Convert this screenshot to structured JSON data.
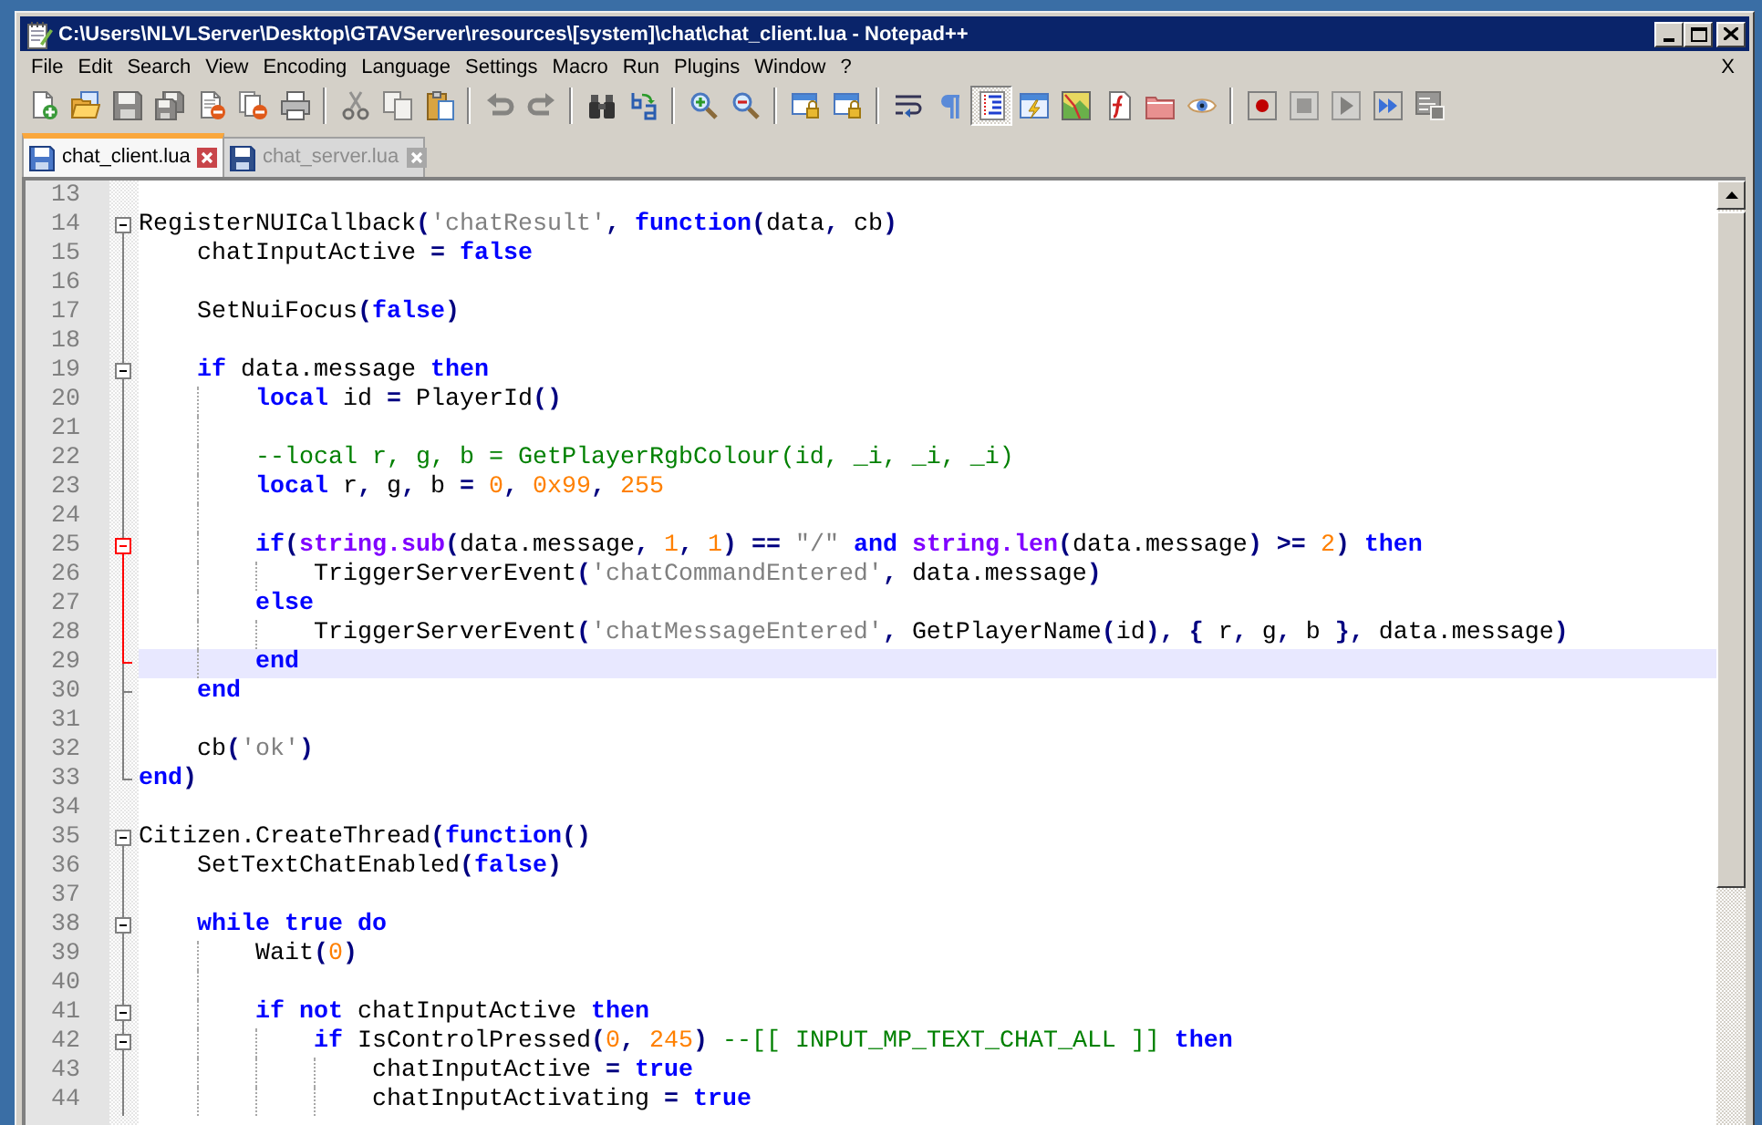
{
  "window": {
    "title": "C:\\Users\\NLVLServer\\Desktop\\GTAVServer\\resources\\[system]\\chat\\chat_client.lua - Notepad++"
  },
  "menu": {
    "items": [
      "File",
      "Edit",
      "Search",
      "View",
      "Encoding",
      "Language",
      "Settings",
      "Macro",
      "Run",
      "Plugins",
      "Window",
      "?"
    ],
    "close_button": "X"
  },
  "toolbar": [
    {
      "kind": "button",
      "disabled": false,
      "pressed": false
    },
    {
      "kind": "button",
      "disabled": false,
      "pressed": false
    },
    {
      "kind": "button",
      "disabled": true,
      "pressed": false
    },
    {
      "kind": "button",
      "disabled": true,
      "pressed": false
    },
    {
      "kind": "button",
      "disabled": false,
      "pressed": false
    },
    {
      "kind": "button",
      "disabled": false,
      "pressed": false
    },
    {
      "kind": "button",
      "disabled": false,
      "pressed": false
    },
    {
      "kind": "separator"
    },
    {
      "kind": "button",
      "disabled": true,
      "pressed": false
    },
    {
      "kind": "button",
      "disabled": true,
      "pressed": false
    },
    {
      "kind": "button",
      "disabled": false,
      "pressed": false
    },
    {
      "kind": "separator"
    },
    {
      "kind": "button",
      "disabled": true,
      "pressed": false
    },
    {
      "kind": "button",
      "disabled": true,
      "pressed": false
    },
    {
      "kind": "separator"
    },
    {
      "kind": "button",
      "disabled": false,
      "pressed": false
    },
    {
      "kind": "button",
      "disabled": false,
      "pressed": false
    },
    {
      "kind": "separator"
    },
    {
      "kind": "button",
      "disabled": false,
      "pressed": false
    },
    {
      "kind": "button",
      "disabled": false,
      "pressed": false
    },
    {
      "kind": "separator"
    },
    {
      "kind": "button",
      "disabled": false,
      "pressed": false
    },
    {
      "kind": "button",
      "disabled": false,
      "pressed": false
    },
    {
      "kind": "separator"
    },
    {
      "kind": "button",
      "disabled": false,
      "pressed": false
    },
    {
      "kind": "button",
      "disabled": false,
      "pressed": false
    },
    {
      "kind": "button",
      "disabled": false,
      "pressed": true
    },
    {
      "kind": "button",
      "disabled": false,
      "pressed": false
    },
    {
      "kind": "button",
      "disabled": false,
      "pressed": false
    },
    {
      "kind": "button",
      "disabled": false,
      "pressed": false
    },
    {
      "kind": "button",
      "disabled": false,
      "pressed": false
    },
    {
      "kind": "button",
      "disabled": false,
      "pressed": false
    },
    {
      "kind": "separator"
    },
    {
      "kind": "button",
      "disabled": false,
      "pressed": false
    },
    {
      "kind": "button",
      "disabled": true,
      "pressed": false
    },
    {
      "kind": "button",
      "disabled": true,
      "pressed": false
    },
    {
      "kind": "button",
      "disabled": false,
      "pressed": false
    },
    {
      "kind": "button",
      "disabled": true,
      "pressed": false
    }
  ],
  "tabs": [
    {
      "label": "chat_client.lua",
      "selected": true
    },
    {
      "label": "chat_server.lua",
      "selected": false
    }
  ],
  "editor": {
    "lines": [
      {
        "number": "13",
        "kind": "plain",
        "current": false
      },
      {
        "number": "14",
        "kind": "head",
        "current": false,
        "fold_active": false,
        "tokens": [
          {
            "kind": "plain",
            "text": "RegisterNUICallback"
          },
          {
            "kind": "operator",
            "text": "("
          },
          {
            "kind": "string",
            "text": "'chatResult'"
          },
          {
            "kind": "operator",
            "text": ", "
          },
          {
            "kind": "keyword",
            "text": "function"
          },
          {
            "kind": "operator",
            "text": "("
          },
          {
            "kind": "plain",
            "text": "data"
          },
          {
            "kind": "operator",
            "text": ", "
          },
          {
            "kind": "plain",
            "text": "cb"
          },
          {
            "kind": "operator",
            "text": ")"
          }
        ],
        "children": [
          {
            "number": "15",
            "kind": "body",
            "current": false,
            "fold_active": false,
            "tokens": [
              {
                "kind": "plain",
                "text": "chatInputActive "
              },
              {
                "kind": "operator",
                "text": "= "
              },
              {
                "kind": "keyword",
                "text": "false"
              }
            ]
          },
          {
            "number": "16",
            "kind": "body",
            "current": false,
            "fold_active": false
          },
          {
            "number": "17",
            "kind": "body",
            "current": false,
            "fold_active": false,
            "tokens": [
              {
                "kind": "plain",
                "text": "SetNuiFocus"
              },
              {
                "kind": "operator",
                "text": "("
              },
              {
                "kind": "keyword",
                "text": "false"
              },
              {
                "kind": "operator",
                "text": ")"
              }
            ]
          },
          {
            "number": "18",
            "kind": "body",
            "current": false,
            "fold_active": false
          },
          {
            "number": "19",
            "kind": "head",
            "current": false,
            "fold_active": false,
            "tokens": [
              {
                "kind": "keyword",
                "text": "if"
              },
              {
                "kind": "plain",
                "text": " data.message "
              },
              {
                "kind": "keyword",
                "text": "then"
              }
            ],
            "children": [
              {
                "number": "20",
                "kind": "body",
                "current": false,
                "fold_active": false,
                "tokens": [
                  {
                    "kind": "keyword",
                    "text": "local"
                  },
                  {
                    "kind": "plain",
                    "text": " id "
                  },
                  {
                    "kind": "operator",
                    "text": "= "
                  },
                  {
                    "kind": "plain",
                    "text": "PlayerId"
                  },
                  {
                    "kind": "operator",
                    "text": "()"
                  }
                ]
              },
              {
                "number": "21",
                "kind": "body",
                "current": false,
                "fold_active": false
              },
              {
                "number": "22",
                "kind": "body",
                "current": false,
                "fold_active": false,
                "tokens": [
                  {
                    "kind": "comment",
                    "text": "--local r, g, b = GetPlayerRgbColour(id, _i, _i, _i)"
                  }
                ]
              },
              {
                "number": "23",
                "kind": "body",
                "current": false,
                "fold_active": false,
                "tokens": [
                  {
                    "kind": "keyword",
                    "text": "local"
                  },
                  {
                    "kind": "plain",
                    "text": " r"
                  },
                  {
                    "kind": "operator",
                    "text": ", "
                  },
                  {
                    "kind": "plain",
                    "text": "g"
                  },
                  {
                    "kind": "operator",
                    "text": ", "
                  },
                  {
                    "kind": "plain",
                    "text": "b "
                  },
                  {
                    "kind": "operator",
                    "text": "= "
                  },
                  {
                    "kind": "number",
                    "text": "0"
                  },
                  {
                    "kind": "operator",
                    "text": ", "
                  },
                  {
                    "kind": "number",
                    "text": "0x99"
                  },
                  {
                    "kind": "operator",
                    "text": ", "
                  },
                  {
                    "kind": "number",
                    "text": "255"
                  }
                ]
              },
              {
                "number": "24",
                "kind": "body",
                "current": false,
                "fold_active": false
              },
              {
                "number": "25",
                "kind": "head",
                "current": false,
                "fold_active": true,
                "tokens": [
                  {
                    "kind": "keyword",
                    "text": "if"
                  },
                  {
                    "kind": "operator",
                    "text": "("
                  },
                  {
                    "kind": "library",
                    "text": "string.sub"
                  },
                  {
                    "kind": "operator",
                    "text": "("
                  },
                  {
                    "kind": "plain",
                    "text": "data.message"
                  },
                  {
                    "kind": "operator",
                    "text": ", "
                  },
                  {
                    "kind": "number",
                    "text": "1"
                  },
                  {
                    "kind": "operator",
                    "text": ", "
                  },
                  {
                    "kind": "number",
                    "text": "1"
                  },
                  {
                    "kind": "operator",
                    "text": ") == "
                  },
                  {
                    "kind": "string",
                    "text": "\"/\""
                  },
                  {
                    "kind": "keyword",
                    "text": " and "
                  },
                  {
                    "kind": "library",
                    "text": "string.len"
                  },
                  {
                    "kind": "operator",
                    "text": "("
                  },
                  {
                    "kind": "plain",
                    "text": "data.message"
                  },
                  {
                    "kind": "operator",
                    "text": ") >= "
                  },
                  {
                    "kind": "number",
                    "text": "2"
                  },
                  {
                    "kind": "operator",
                    "text": ") "
                  },
                  {
                    "kind": "keyword",
                    "text": "then"
                  }
                ],
                "children": [
                  {
                    "number": "26",
                    "kind": "body",
                    "current": false,
                    "fold_active": true,
                    "tokens": [
                      {
                        "kind": "plain",
                        "text": "TriggerServerEvent"
                      },
                      {
                        "kind": "operator",
                        "text": "("
                      },
                      {
                        "kind": "string",
                        "text": "'chatCommandEntered'"
                      },
                      {
                        "kind": "operator",
                        "text": ", "
                      },
                      {
                        "kind": "plain",
                        "text": "data.message"
                      },
                      {
                        "kind": "operator",
                        "text": ")"
                      }
                    ]
                  }
                ]
              },
              {
                "number": "27",
                "kind": "body",
                "current": false,
                "fold_active": true,
                "tokens": [
                  {
                    "kind": "keyword",
                    "text": "else"
                  }
                ],
                "children": [
                  {
                    "number": "28",
                    "kind": "body",
                    "current": false,
                    "fold_active": true,
                    "tokens": [
                      {
                        "kind": "plain",
                        "text": "TriggerServerEvent"
                      },
                      {
                        "kind": "operator",
                        "text": "("
                      },
                      {
                        "kind": "string",
                        "text": "'chatMessageEntered'"
                      },
                      {
                        "kind": "operator",
                        "text": ", "
                      },
                      {
                        "kind": "plain",
                        "text": "GetPlayerName"
                      },
                      {
                        "kind": "operator",
                        "text": "("
                      },
                      {
                        "kind": "plain",
                        "text": "id"
                      },
                      {
                        "kind": "operator",
                        "text": "), { "
                      },
                      {
                        "kind": "plain",
                        "text": "r"
                      },
                      {
                        "kind": "operator",
                        "text": ", "
                      },
                      {
                        "kind": "plain",
                        "text": "g"
                      },
                      {
                        "kind": "operator",
                        "text": ", "
                      },
                      {
                        "kind": "plain",
                        "text": "b "
                      },
                      {
                        "kind": "operator",
                        "text": "}, "
                      },
                      {
                        "kind": "plain",
                        "text": "data.message"
                      },
                      {
                        "kind": "operator",
                        "text": ")"
                      }
                    ]
                  }
                ]
              },
              {
                "number": "29",
                "kind": "tail",
                "current": true,
                "fold_active": true,
                "tokens": [
                  {
                    "kind": "keyword",
                    "text": "end"
                  }
                ]
              }
            ]
          },
          {
            "number": "30",
            "kind": "tail",
            "current": false,
            "fold_active": false,
            "tokens": [
              {
                "kind": "keyword",
                "text": "end"
              }
            ]
          },
          {
            "number": "31",
            "kind": "body",
            "current": false,
            "fold_active": false
          },
          {
            "number": "32",
            "kind": "body",
            "current": false,
            "fold_active": false,
            "tokens": [
              {
                "kind": "plain",
                "text": "cb"
              },
              {
                "kind": "operator",
                "text": "("
              },
              {
                "kind": "string",
                "text": "'ok'"
              },
              {
                "kind": "operator",
                "text": ")"
              }
            ]
          }
        ]
      },
      {
        "number": "33",
        "kind": "tail",
        "current": false,
        "fold_active": false,
        "tokens": [
          {
            "kind": "keyword",
            "text": "end"
          },
          {
            "kind": "operator",
            "text": ")"
          }
        ]
      },
      {
        "number": "34",
        "kind": "plain",
        "current": false
      },
      {
        "number": "35",
        "kind": "head",
        "current": false,
        "fold_active": false,
        "tokens": [
          {
            "kind": "plain",
            "text": "Citizen.CreateThread"
          },
          {
            "kind": "operator",
            "text": "("
          },
          {
            "kind": "keyword",
            "text": "function"
          },
          {
            "kind": "operator",
            "text": "()"
          }
        ],
        "children": [
          {
            "number": "36",
            "kind": "body",
            "current": false,
            "fold_active": false,
            "tokens": [
              {
                "kind": "plain",
                "text": "SetTextChatEnabled"
              },
              {
                "kind": "operator",
                "text": "("
              },
              {
                "kind": "keyword",
                "text": "false"
              },
              {
                "kind": "operator",
                "text": ")"
              }
            ]
          },
          {
            "number": "37",
            "kind": "body",
            "current": false,
            "fold_active": false
          },
          {
            "number": "38",
            "kind": "head",
            "current": false,
            "fold_active": false,
            "tokens": [
              {
                "kind": "keyword",
                "text": "while true do"
              }
            ],
            "children": [
              {
                "number": "39",
                "kind": "body",
                "current": false,
                "fold_active": false,
                "tokens": [
                  {
                    "kind": "plain",
                    "text": "Wait"
                  },
                  {
                    "kind": "operator",
                    "text": "("
                  },
                  {
                    "kind": "number",
                    "text": "0"
                  },
                  {
                    "kind": "operator",
                    "text": ")"
                  }
                ]
              },
              {
                "number": "40",
                "kind": "body",
                "current": false,
                "fold_active": false
              },
              {
                "number": "41",
                "kind": "head",
                "current": false,
                "fold_active": false,
                "tokens": [
                  {
                    "kind": "keyword",
                    "text": "if not"
                  },
                  {
                    "kind": "plain",
                    "text": " chatInputActive "
                  },
                  {
                    "kind": "keyword",
                    "text": "then"
                  }
                ],
                "children": [
                  {
                    "number": "42",
                    "kind": "head",
                    "current": false,
                    "fold_active": false,
                    "tokens": [
                      {
                        "kind": "keyword",
                        "text": "if"
                      },
                      {
                        "kind": "plain",
                        "text": " IsControlPressed"
                      },
                      {
                        "kind": "operator",
                        "text": "("
                      },
                      {
                        "kind": "number",
                        "text": "0"
                      },
                      {
                        "kind": "operator",
                        "text": ", "
                      },
                      {
                        "kind": "number",
                        "text": "245"
                      },
                      {
                        "kind": "operator",
                        "text": ") "
                      },
                      {
                        "kind": "comment",
                        "text": "--[[ INPUT_MP_TEXT_CHAT_ALL ]]"
                      },
                      {
                        "kind": "keyword",
                        "text": " then"
                      }
                    ],
                    "children": [
                      {
                        "number": "43",
                        "kind": "body",
                        "current": false,
                        "fold_active": false,
                        "tokens": [
                          {
                            "kind": "plain",
                            "text": "chatInputActive "
                          },
                          {
                            "kind": "operator",
                            "text": "= "
                          },
                          {
                            "kind": "keyword",
                            "text": "true"
                          }
                        ]
                      },
                      {
                        "number": "44",
                        "kind": "body",
                        "current": false,
                        "fold_active": false,
                        "tokens": [
                          {
                            "kind": "plain",
                            "text": "chatInputActivating "
                          },
                          {
                            "kind": "operator",
                            "text": "= "
                          },
                          {
                            "kind": "keyword",
                            "text": "true"
                          }
                        ]
                      }
                    ]
                  }
                ]
              }
            ]
          }
        ]
      }
    ]
  }
}
